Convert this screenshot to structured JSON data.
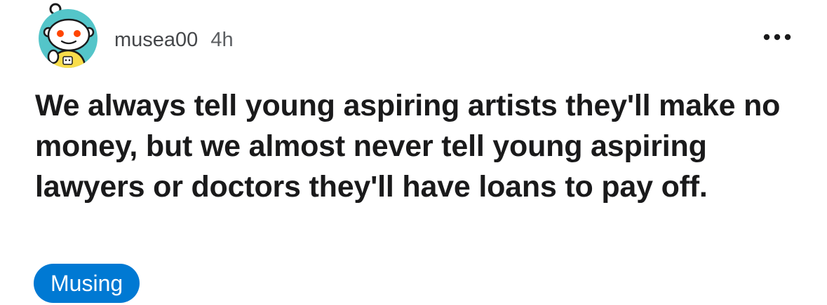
{
  "post": {
    "author": "musea00",
    "time_ago": "4h",
    "title": "We always tell young aspiring artists they'll make no money, but we almost never tell young aspiring lawyers or doctors they'll have loans to pay off.",
    "flair": "Musing"
  },
  "icons": {
    "avatar": "snoo-avatar",
    "more": "more-options-icon"
  },
  "colors": {
    "flair_background": "#0079d3",
    "flair_text": "#ffffff",
    "avatar_background": "#54c5c9",
    "title_text": "#1a1a1b"
  }
}
